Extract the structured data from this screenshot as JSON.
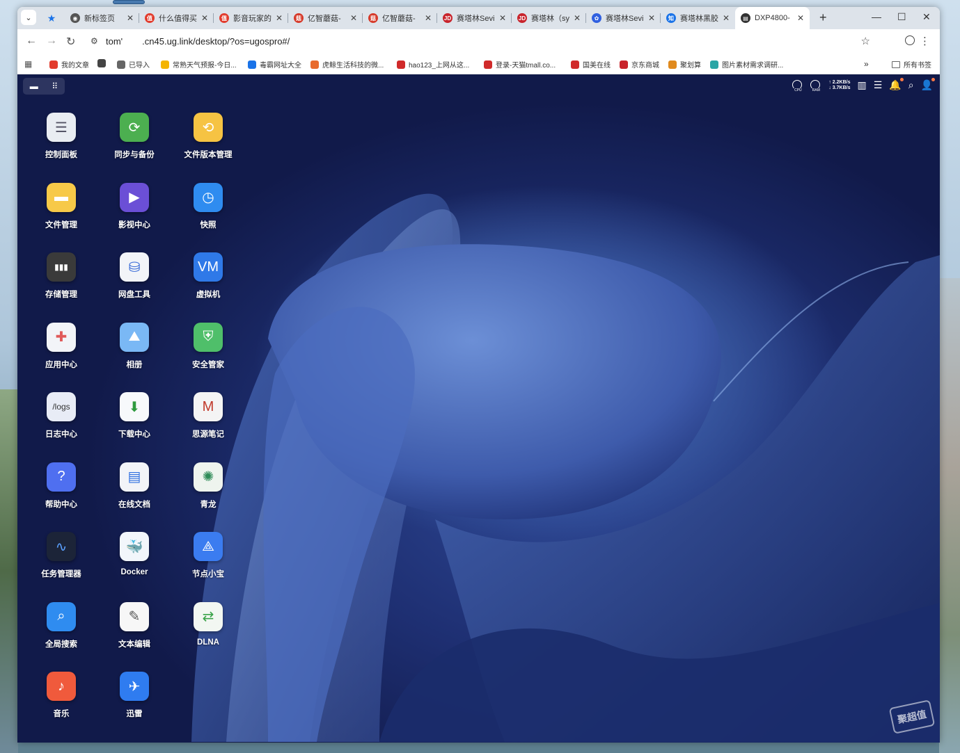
{
  "browser": {
    "tabs": [
      {
        "title": "新标签页",
        "color": "#555555",
        "icon": "chrome-icon"
      },
      {
        "title": "什么值得买",
        "color": "#e23c2d",
        "icon": "smzdm-icon"
      },
      {
        "title": "影音玩家的",
        "color": "#e23c2d",
        "icon": "smzdm-icon"
      },
      {
        "title": "亿智蘑菇-",
        "color": "#d63a2a",
        "icon": "mushroom-icon"
      },
      {
        "title": "亿智蘑菇-",
        "color": "#d63a2a",
        "icon": "mushroom-icon"
      },
      {
        "title": "赛塔林Sevi",
        "color": "#c8242c",
        "icon": "jd-icon"
      },
      {
        "title": "赛塔林（sy",
        "color": "#c8242c",
        "icon": "jd-icon"
      },
      {
        "title": "赛塔林Sevi",
        "color": "#3060e0",
        "icon": "baidu-icon"
      },
      {
        "title": "赛塔林黑胶",
        "color": "#1a73e8",
        "icon": "zhihu-icon"
      },
      {
        "title": "DXP4800-",
        "color": "#333333",
        "icon": "page-icon",
        "active": true
      }
    ],
    "url_host_prefix": "tom'",
    "url_rest": ".cn45.ug.link/desktop/?os=ugospro#/",
    "bookmarks": [
      {
        "label": "我的文章",
        "color": "#e23c2d"
      },
      {
        "label": "",
        "color": "#444444"
      },
      {
        "label": "已导入",
        "color": "#666666"
      },
      {
        "label": "常熟天气预报-今日...",
        "color": "#f4b400"
      },
      {
        "label": "毒霸网址大全",
        "color": "#1a73e8"
      },
      {
        "label": "虎鲸生活科技的微...",
        "color": "#e86b2d"
      },
      {
        "label": "hao123_上网从这...",
        "color": "#d02a2a"
      },
      {
        "label": "登录-天猫tmall.co...",
        "color": "#d02a2a"
      },
      {
        "label": "国美在线",
        "color": "#d02a2a"
      },
      {
        "label": "京东商城",
        "color": "#c8242c"
      },
      {
        "label": "聚划算",
        "color": "#e08a1e"
      },
      {
        "label": "图片素材需求调研...",
        "color": "#2aa5a5"
      }
    ],
    "bookmarks_more": "»",
    "all_bookmarks": "所有书签"
  },
  "desktop": {
    "net_up": "↑ 2.2KB/s",
    "net_down": "↓ 3.7KB/s",
    "gauge_cpu": "CPU",
    "gauge_ram": "RAM",
    "apps": [
      {
        "label": "控制面板",
        "icon": "control-panel-icon",
        "bg": "#e9edf2",
        "fg": "#556"
      },
      {
        "label": "同步与备份",
        "icon": "sync-icon",
        "bg": "#4caf50",
        "fg": "#fff"
      },
      {
        "label": "文件版本管理",
        "icon": "version-icon",
        "bg": "#f6c343",
        "fg": "#fff"
      },
      {
        "label": "文件管理",
        "icon": "folder-icon",
        "bg": "#f7c948",
        "fg": "#fff"
      },
      {
        "label": "影视中心",
        "icon": "video-icon",
        "bg": "#6b4fd6",
        "fg": "#fff"
      },
      {
        "label": "快照",
        "icon": "snapshot-icon",
        "bg": "#2f8cf0",
        "fg": "#fff"
      },
      {
        "label": "存储管理",
        "icon": "storage-icon",
        "bg": "#3a3a3a",
        "fg": "#fff"
      },
      {
        "label": "网盘工具",
        "icon": "cloud-drive-icon",
        "bg": "#f2f4f8",
        "fg": "#3266d6"
      },
      {
        "label": "虚拟机",
        "icon": "vm-icon",
        "bg": "#2f79e8",
        "fg": "#fff"
      },
      {
        "label": "应用中心",
        "icon": "app-center-icon",
        "bg": "#f2f4f8",
        "fg": "#e05a5a"
      },
      {
        "label": "相册",
        "icon": "album-icon",
        "bg": "#7ab8f5",
        "fg": "#fff"
      },
      {
        "label": "安全管家",
        "icon": "shield-icon",
        "bg": "#4fbf6a",
        "fg": "#fff"
      },
      {
        "label": "日志中心",
        "icon": "logs-icon",
        "bg": "#e8ecf6",
        "fg": "#333"
      },
      {
        "label": "下载中心",
        "icon": "download-icon",
        "bg": "#f7f9fb",
        "fg": "#2e9a3e"
      },
      {
        "label": "思源笔记",
        "icon": "siyuan-icon",
        "bg": "#f4f4f4",
        "fg": "#c0392b"
      },
      {
        "label": "帮助中心",
        "icon": "help-icon",
        "bg": "#4f6ff0",
        "fg": "#fff"
      },
      {
        "label": "在线文档",
        "icon": "document-icon",
        "bg": "#f2f4f8",
        "fg": "#2f6fe0"
      },
      {
        "label": "青龙",
        "icon": "qinglong-icon",
        "bg": "#eef4ee",
        "fg": "#2e8b57"
      },
      {
        "label": "任务管理器",
        "icon": "task-manager-icon",
        "bg": "#1c2438",
        "fg": "#5aa0ff"
      },
      {
        "label": "Docker",
        "icon": "docker-icon",
        "bg": "#f2f6fb",
        "fg": "#2496ed"
      },
      {
        "label": "节点小宝",
        "icon": "node-icon",
        "bg": "#3b7cf0",
        "fg": "#fff"
      },
      {
        "label": "全局搜索",
        "icon": "search-icon",
        "bg": "#2f8cf0",
        "fg": "#fff"
      },
      {
        "label": "文本编辑",
        "icon": "text-editor-icon",
        "bg": "#f7f7f7",
        "fg": "#555"
      },
      {
        "label": "DLNA",
        "icon": "dlna-icon",
        "bg": "#f2f7f2",
        "fg": "#3aa34a"
      },
      {
        "label": "音乐",
        "icon": "music-icon",
        "bg": "#f05a3c",
        "fg": "#fff"
      },
      {
        "label": "迅雷",
        "icon": "xunlei-icon",
        "bg": "#2f7cf0",
        "fg": "#fff"
      }
    ]
  },
  "watermark": "聚超值"
}
